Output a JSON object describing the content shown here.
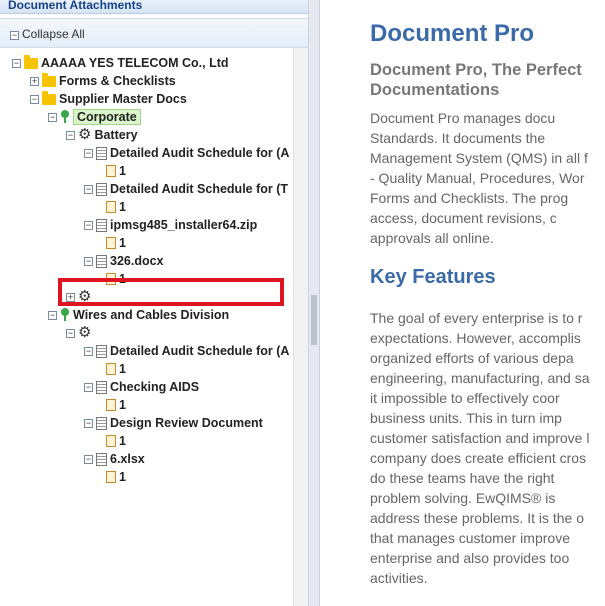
{
  "left_panel": {
    "title": "Document Attachments",
    "collapse_label": "Collapse All"
  },
  "tree": {
    "root": "AAAAA YES TELECOM Co., Ltd",
    "forms": "Forms & Checklists",
    "supplier": "Supplier Master Docs",
    "corporate": "Corporate",
    "battery": "Battery",
    "doc1": "Detailed Audit Schedule for (A",
    "doc2": "Detailed Audit Schedule for (T",
    "doc3": "ipmsg485_installer64.zip",
    "doc4": "326.docx",
    "wires": "Wires and Cables Division",
    "doc5": "Detailed Audit Schedule for (A",
    "doc6": "Checking AIDS",
    "doc7": "Design Review Document",
    "doc8": "6.xlsx",
    "file_label": "1"
  },
  "content": {
    "title": "Document Pro",
    "subtitle_lines": [
      "Document Pro, The Perfect",
      "Documentations"
    ],
    "para1_lines": [
      "Document  Pro  manages  docu",
      "Standards.  It  documents  the",
      "Management System (QMS) in all f",
      "- Quality Manual, Procedures, Wor",
      "Forms  and  Checklists.  The  prog",
      "access,   document   revisions,   c",
      "approvals all online."
    ],
    "features_title": "Key Features",
    "para2_lines": [
      "The goal of every enterprise is to r",
      "expectations.  However,  accomplis",
      "organized efforts of various depa",
      "engineering, manufacturing, and sa",
      "it  impossible  to  effectively  coor",
      "business  units.  This  in  turn  imp",
      "customer satisfaction and improve l",
      "company does create efficient cros",
      "do  these  teams  have  the  right",
      "problem  solving.  EwQIMS®  is",
      "address these problems. It is the o",
      "that  manages  customer  improve",
      "enterprise  and  also  provides  too",
      "activities."
    ]
  }
}
